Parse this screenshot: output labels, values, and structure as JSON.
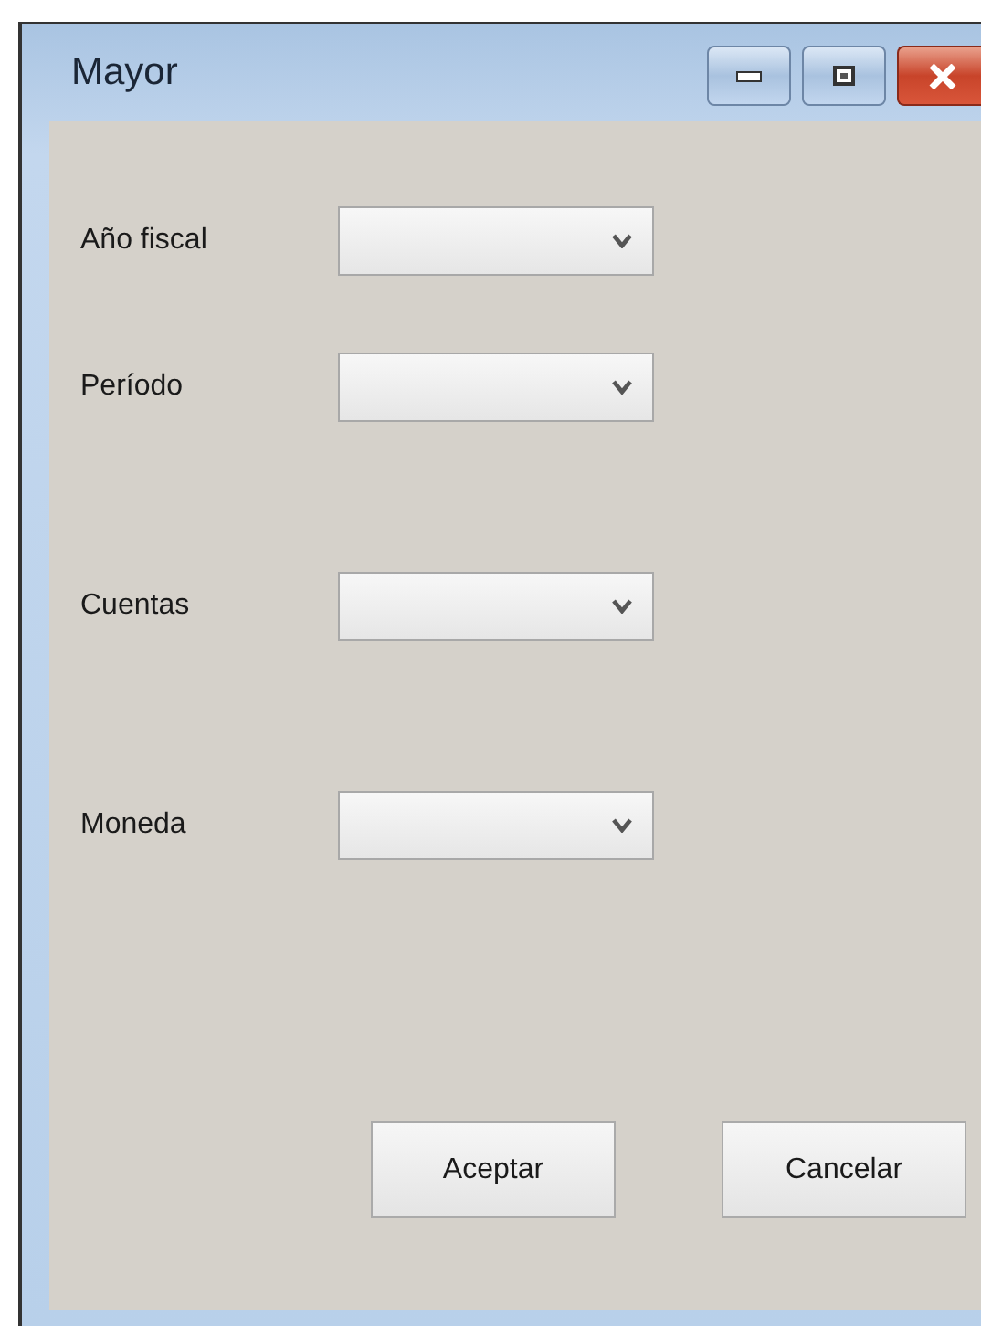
{
  "window": {
    "title": "Mayor"
  },
  "fields": [
    {
      "label": "Año fiscal"
    },
    {
      "label": "Período"
    },
    {
      "label": "Cuentas"
    },
    {
      "label": "Moneda"
    }
  ],
  "buttons": [
    "Aceptar",
    "Cancelar"
  ]
}
